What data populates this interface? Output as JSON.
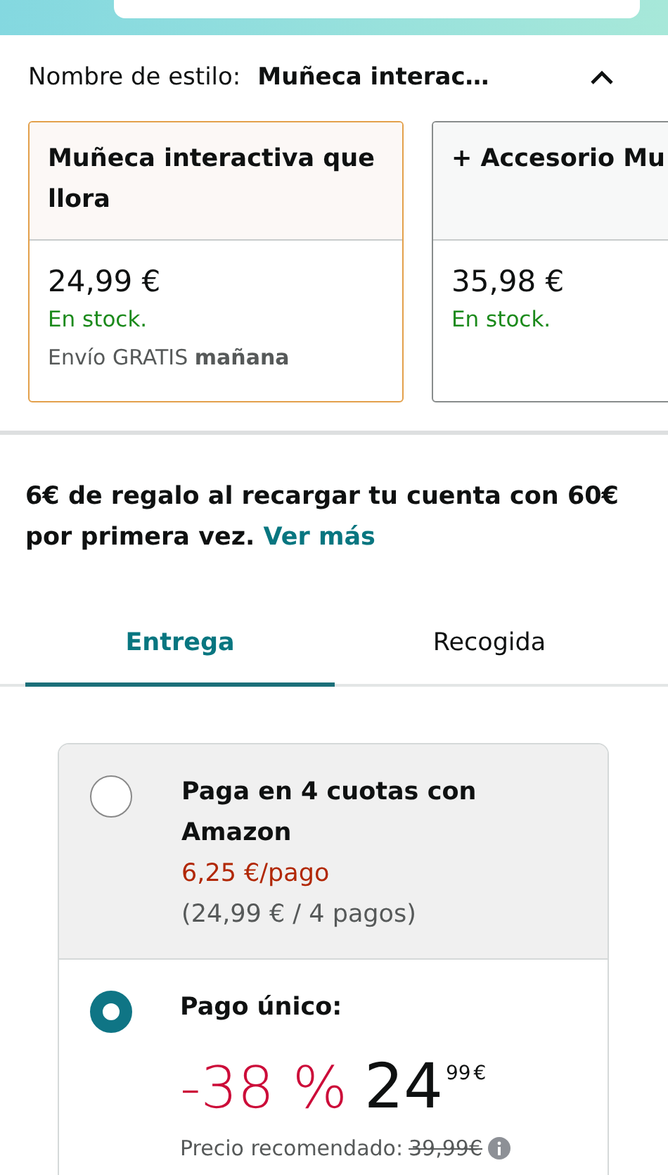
{
  "style_selector": {
    "label": "Nombre de estilo:",
    "value": "Muñeca interac…",
    "expanded": true
  },
  "style_options": [
    {
      "name": "Muñeca interactiva que llora",
      "price": "24,99 €",
      "stock": "En stock.",
      "shipping": "Envío GRATIS **mañana**",
      "selected": true
    },
    {
      "name": "+ Accesorio Mu",
      "price": "35,98 €",
      "stock": "En stock.",
      "selected": false
    }
  ],
  "promo": {
    "text": "6€ de regalo al recargar tu cuenta con 60€ por primera vez.",
    "link": "Ver más"
  },
  "tabs": [
    {
      "label": "Entrega",
      "selected": true
    },
    {
      "label": "Recogida",
      "selected": false
    }
  ],
  "payment_options": [
    {
      "kind": "installments",
      "title": "Paga en 4 cuotas con Amazon",
      "per_payment": "6,25 €/pago",
      "detail": "(24,99 € / 4 pagos)",
      "selected": false
    },
    {
      "kind": "single",
      "title": "Pago único:",
      "discount": "-38 %",
      "price_whole": "24",
      "price_fraction": "99",
      "currency": "€",
      "list_price_label": "Precio recomendado:",
      "list_price": "39,99€",
      "selected": true
    }
  ]
}
